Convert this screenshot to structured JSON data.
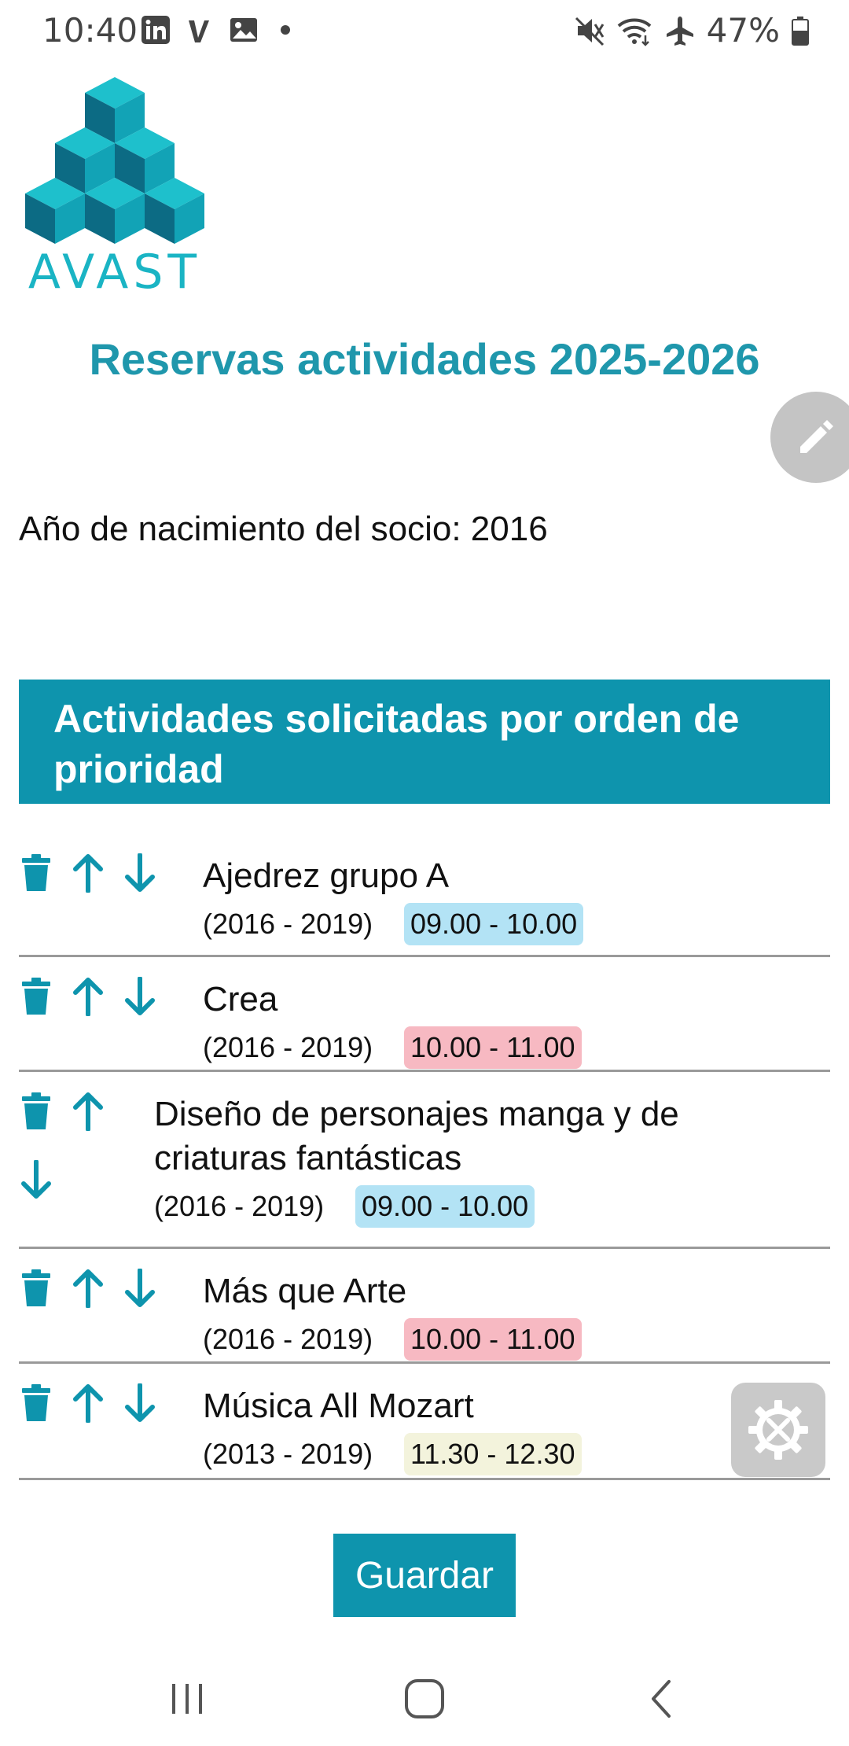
{
  "status_bar": {
    "time": "10:40",
    "battery": "47%",
    "icons": [
      "linkedin-icon",
      "vimeo-icon",
      "image-icon",
      "dot-icon",
      "mute-icon",
      "wifi-icon",
      "airplane-icon",
      "battery-icon"
    ]
  },
  "logo": {
    "text": "AVAST"
  },
  "title": "Reservas actividades 2025-2026",
  "birth_year_text": "Año de nacimiento del socio: 2016",
  "section_header": "Actividades solicitadas por orden de prioridad",
  "colors": {
    "accent": "#0e94ad",
    "title": "#1f97ac",
    "badge_blue": "#b3e3f5",
    "badge_pink": "#f7b9c2",
    "badge_cream": "#f3f3dc"
  },
  "activities": [
    {
      "name": "Ajedrez grupo A",
      "years": "(2016 - 2019)",
      "time": "09.00 - 10.00"
    },
    {
      "name": "Crea",
      "years": "(2016 - 2019)",
      "time": "10.00 - 11.00"
    },
    {
      "name_line1": "Diseño de personajes manga y de",
      "name_line2": "criaturas fantásticas",
      "years": "(2016 - 2019)",
      "time": "09.00 - 10.00"
    },
    {
      "name": "Más que Arte",
      "years": "(2016 - 2019)",
      "time": "10.00 - 11.00"
    },
    {
      "name": "Música All Mozart",
      "years": "(2013 - 2019)",
      "time": "11.30 - 12.30"
    }
  ],
  "save_label": "Guardar",
  "nav": {
    "recents": "recents-icon",
    "home": "home-icon",
    "back": "back-icon"
  }
}
